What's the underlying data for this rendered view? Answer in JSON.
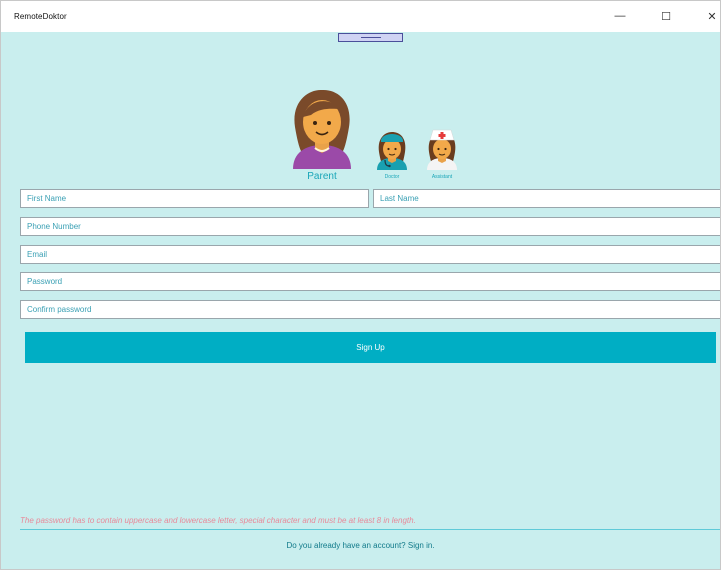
{
  "window": {
    "title": "RemoteDoktor",
    "minimize_glyph": "—",
    "maximize_glyph": "☐",
    "close_glyph": "✕"
  },
  "roles": {
    "parent": {
      "label": "Parent",
      "icon": "woman-avatar-icon"
    },
    "doctor": {
      "label": "Doctor",
      "icon": "doctor-avatar-icon"
    },
    "assistant": {
      "label": "Assistant",
      "icon": "nurse-avatar-icon"
    }
  },
  "form": {
    "first_name": {
      "placeholder": "First Name",
      "value": ""
    },
    "last_name": {
      "placeholder": "Last Name",
      "value": ""
    },
    "phone": {
      "placeholder": "Phone Number",
      "value": ""
    },
    "email": {
      "placeholder": "Email",
      "value": ""
    },
    "password": {
      "placeholder": "Password",
      "value": ""
    },
    "confirm_password": {
      "placeholder": "Confirm password",
      "value": ""
    },
    "signup_label": "Sign Up"
  },
  "password_hint": "The password has to contain uppercase and lowercase letter, special character and must be at least 8 in length.",
  "signin_text": "Do you already have an account? Sign in.",
  "colors": {
    "background": "#c9eeee",
    "accent": "#00aec4",
    "hint": "#e88a9a"
  }
}
